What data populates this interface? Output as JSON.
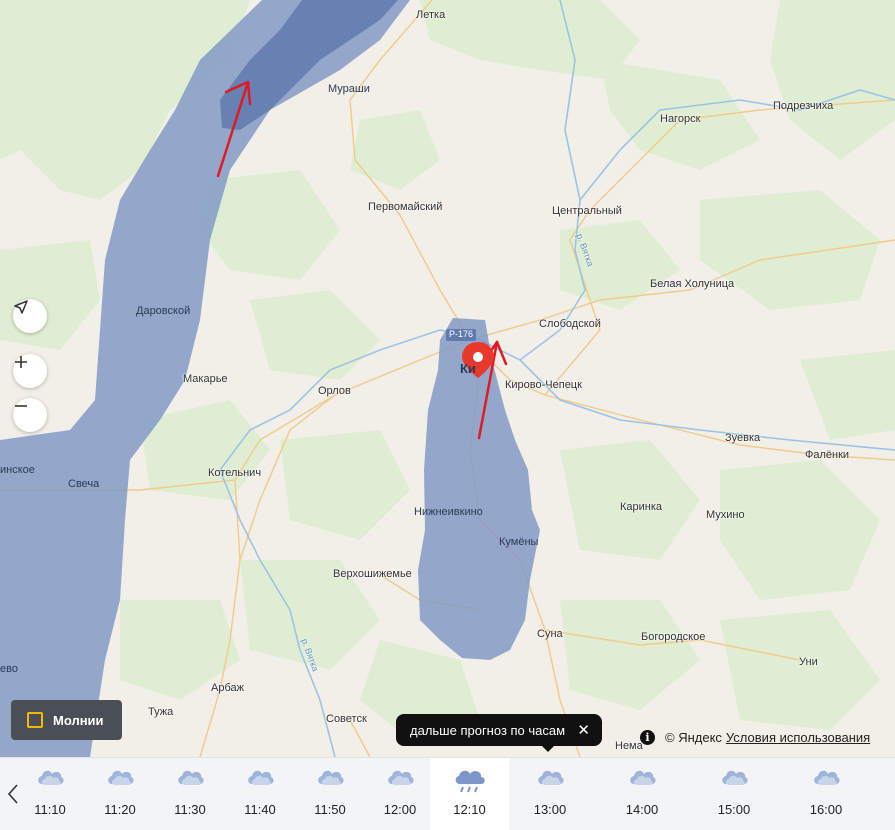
{
  "map": {
    "road_label": "Р-176",
    "river_label": "р. Вятка",
    "places": [
      {
        "id": "letka",
        "name": "Летка"
      },
      {
        "id": "murashi",
        "name": "Мураши"
      },
      {
        "id": "podrezchikha",
        "name": "Подрезчиха"
      },
      {
        "id": "nagorsk",
        "name": "Нагорск"
      },
      {
        "id": "pervomaysky",
        "name": "Первомайский"
      },
      {
        "id": "tsentralny",
        "name": "Центральный"
      },
      {
        "id": "belaya-kholunitsa",
        "name": "Белая Холуница"
      },
      {
        "id": "darovskoy",
        "name": "Даровской"
      },
      {
        "id": "slobodskoy",
        "name": "Слободской"
      },
      {
        "id": "makarye",
        "name": "Макарье"
      },
      {
        "id": "orlov",
        "name": "Орлов"
      },
      {
        "id": "kirov",
        "name": "Ки"
      },
      {
        "id": "kirovo-chepetsk",
        "name": "Кирово-Чепецк"
      },
      {
        "id": "zuevka",
        "name": "Зуевка"
      },
      {
        "id": "falenki",
        "name": "Фалёнки"
      },
      {
        "id": "kotelnich",
        "name": "Котельнич"
      },
      {
        "id": "svecha",
        "name": "Свеча"
      },
      {
        "id": "shabalinskoe",
        "name": "инское"
      },
      {
        "id": "nizhneivkino",
        "name": "Нижнеивкино"
      },
      {
        "id": "karinka",
        "name": "Каринка"
      },
      {
        "id": "mukhino",
        "name": "Мухино"
      },
      {
        "id": "kumeny",
        "name": "Кумёны"
      },
      {
        "id": "verkhoshizhemye",
        "name": "Верхошижемье"
      },
      {
        "id": "suna",
        "name": "Суна"
      },
      {
        "id": "bogorodskoe",
        "name": "Богородское"
      },
      {
        "id": "uni",
        "name": "Уни"
      },
      {
        "id": "lebyazhye-cut",
        "name": "ево"
      },
      {
        "id": "arbazh",
        "name": "Арбаж"
      },
      {
        "id": "tuzha",
        "name": "Тужа"
      },
      {
        "id": "sovetsk",
        "name": "Советск"
      },
      {
        "id": "nema",
        "name": "Нема"
      }
    ]
  },
  "controls": {
    "locate_icon": "location-arrow-icon",
    "zoom_in_icon": "plus-icon",
    "zoom_out_icon": "minus-icon"
  },
  "lightning": {
    "label": "Молнии",
    "checked": false,
    "accent": "#f5b800"
  },
  "tooltip": {
    "text": "дальше прогноз по часам"
  },
  "copyright": {
    "text": "© Яндекс",
    "terms": "Условия использования"
  },
  "colors": {
    "precipitation": "#7f97c4",
    "precipitation_heavy": "#5f7aae",
    "pin": "#e8392c",
    "arrows": "#e01a22"
  },
  "timeline": {
    "selected": "12:10",
    "slots": [
      {
        "time": "11:10",
        "icon": "cloud-icon"
      },
      {
        "time": "11:20",
        "icon": "cloud-icon"
      },
      {
        "time": "11:30",
        "icon": "cloud-icon"
      },
      {
        "time": "11:40",
        "icon": "cloud-icon"
      },
      {
        "time": "11:50",
        "icon": "cloud-icon"
      },
      {
        "time": "12:00",
        "icon": "cloud-icon"
      },
      {
        "time": "12:10",
        "icon": "rain-cloud-icon"
      },
      {
        "time": "13:00",
        "icon": "cloud-icon"
      },
      {
        "time": "14:00",
        "icon": "cloud-icon"
      },
      {
        "time": "15:00",
        "icon": "cloud-icon"
      },
      {
        "time": "16:00",
        "icon": "cloud-icon"
      }
    ]
  }
}
